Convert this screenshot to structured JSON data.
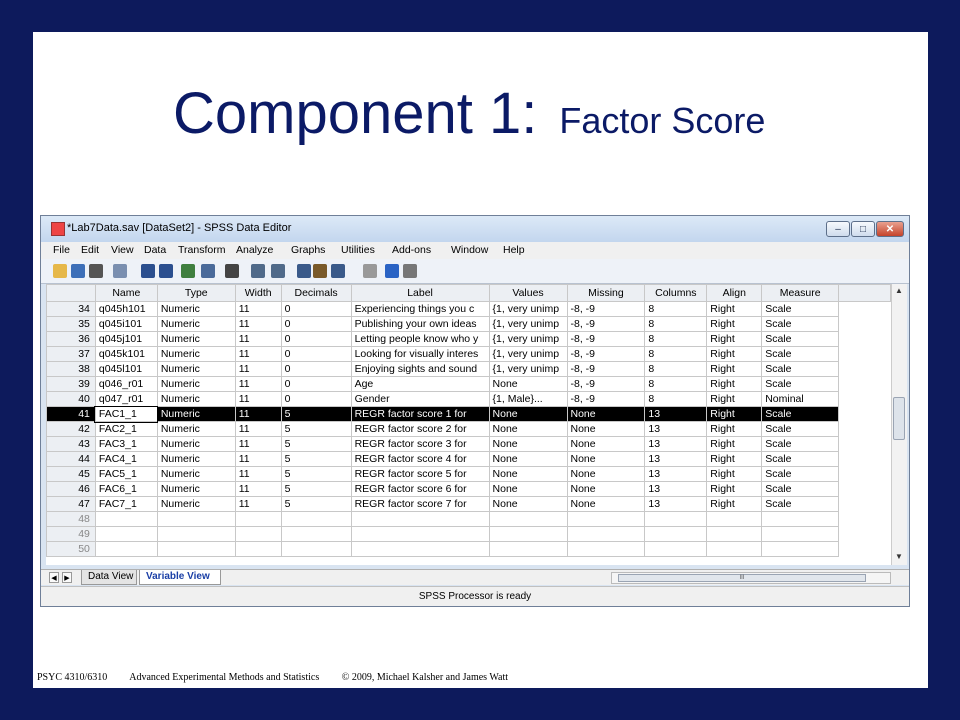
{
  "slide": {
    "title_main": "Component 1:",
    "title_sub": "Factor Score",
    "footer": {
      "course": "PSYC 4310/6310",
      "course_title": "Advanced Experimental Methods and Statistics",
      "copyright": "© 2009, Michael Kalsher and James Watt"
    }
  },
  "window": {
    "title": "*Lab7Data.sav [DataSet2] - SPSS Data Editor",
    "controls": {
      "minimize": "–",
      "maximize": "□",
      "close": "✕"
    }
  },
  "menu": [
    "File",
    "Edit",
    "View",
    "Data",
    "Transform",
    "Analyze",
    "Graphs",
    "Utilities",
    "Add-ons",
    "Window",
    "Help"
  ],
  "toolbar_icons": [
    "open-icon",
    "save-icon",
    "print-icon",
    "dialog-recall-icon",
    "undo-icon",
    "redo-icon",
    "goto-case-icon",
    "variables-icon",
    "find-icon",
    "insert-cases-icon",
    "insert-variable-icon",
    "split-file-icon",
    "weight-cases-icon",
    "select-cases-icon",
    "value-labels-icon",
    "use-sets-icon",
    "show-all-icon"
  ],
  "grid": {
    "columns": [
      "Name",
      "Type",
      "Width",
      "Decimals",
      "Label",
      "Values",
      "Missing",
      "Columns",
      "Align",
      "Measure"
    ],
    "rows": [
      {
        "n": "34",
        "cells": [
          "q045h101",
          "Numeric",
          "11",
          "0",
          "Experiencing things you c",
          "{1, very unimp",
          "-8, -9",
          "8",
          "Right",
          "Scale"
        ]
      },
      {
        "n": "35",
        "cells": [
          "q045i101",
          "Numeric",
          "11",
          "0",
          "Publishing your own ideas",
          "{1, very unimp",
          "-8, -9",
          "8",
          "Right",
          "Scale"
        ]
      },
      {
        "n": "36",
        "cells": [
          "q045j101",
          "Numeric",
          "11",
          "0",
          "Letting people know who y",
          "{1, very unimp",
          "-8, -9",
          "8",
          "Right",
          "Scale"
        ]
      },
      {
        "n": "37",
        "cells": [
          "q045k101",
          "Numeric",
          "11",
          "0",
          "Looking for visually interes",
          "{1, very unimp",
          "-8, -9",
          "8",
          "Right",
          "Scale"
        ]
      },
      {
        "n": "38",
        "cells": [
          "q045l101",
          "Numeric",
          "11",
          "0",
          "Enjoying sights and sound",
          "{1, very unimp",
          "-8, -9",
          "8",
          "Right",
          "Scale"
        ]
      },
      {
        "n": "39",
        "cells": [
          "q046_r01",
          "Numeric",
          "11",
          "0",
          "Age",
          "None",
          "-8, -9",
          "8",
          "Right",
          "Scale"
        ]
      },
      {
        "n": "40",
        "cells": [
          "q047_r01",
          "Numeric",
          "11",
          "0",
          "Gender",
          "{1, Male}...",
          "-8, -9",
          "8",
          "Right",
          "Nominal"
        ]
      },
      {
        "n": "41",
        "cells": [
          "FAC1_1",
          "Numeric",
          "11",
          "5",
          "REGR factor score   1 for",
          "None",
          "None",
          "13",
          "Right",
          "Scale"
        ],
        "selected": true
      },
      {
        "n": "42",
        "cells": [
          "FAC2_1",
          "Numeric",
          "11",
          "5",
          "REGR factor score   2 for",
          "None",
          "None",
          "13",
          "Right",
          "Scale"
        ]
      },
      {
        "n": "43",
        "cells": [
          "FAC3_1",
          "Numeric",
          "11",
          "5",
          "REGR factor score   3 for",
          "None",
          "None",
          "13",
          "Right",
          "Scale"
        ]
      },
      {
        "n": "44",
        "cells": [
          "FAC4_1",
          "Numeric",
          "11",
          "5",
          "REGR factor score   4 for",
          "None",
          "None",
          "13",
          "Right",
          "Scale"
        ]
      },
      {
        "n": "45",
        "cells": [
          "FAC5_1",
          "Numeric",
          "11",
          "5",
          "REGR factor score   5 for",
          "None",
          "None",
          "13",
          "Right",
          "Scale"
        ]
      },
      {
        "n": "46",
        "cells": [
          "FAC6_1",
          "Numeric",
          "11",
          "5",
          "REGR factor score   6 for",
          "None",
          "None",
          "13",
          "Right",
          "Scale"
        ]
      },
      {
        "n": "47",
        "cells": [
          "FAC7_1",
          "Numeric",
          "11",
          "5",
          "REGR factor score   7 for",
          "None",
          "None",
          "13",
          "Right",
          "Scale"
        ]
      },
      {
        "n": "48",
        "cells": [
          "",
          "",
          "",
          "",
          "",
          "",
          "",
          "",
          "",
          ""
        ],
        "empty": true
      },
      {
        "n": "49",
        "cells": [
          "",
          "",
          "",
          "",
          "",
          "",
          "",
          "",
          "",
          ""
        ],
        "empty": true
      },
      {
        "n": "50",
        "cells": [
          "",
          "",
          "",
          "",
          "",
          "",
          "",
          "",
          "",
          ""
        ],
        "empty": true
      }
    ]
  },
  "tabs": {
    "data_view": "Data View",
    "variable_view": "Variable View",
    "active": "variable_view"
  },
  "hscroll_grip": "III",
  "status": "SPSS Processor is ready",
  "colors": {
    "frame": "#0d1a5c",
    "title": "#0b1a66",
    "selected_row": "#000000",
    "active_tab_text": "#1a3fa6"
  }
}
